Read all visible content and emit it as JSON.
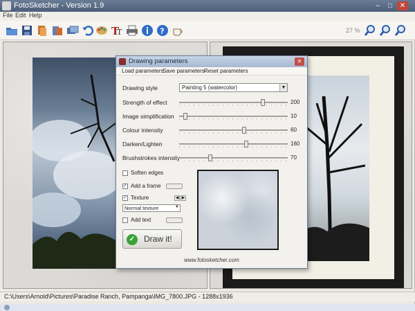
{
  "window": {
    "title": "FotoSketcher - Version 1.9"
  },
  "menu": {
    "items": [
      "File",
      "Edit",
      "Help"
    ]
  },
  "toolbar": {
    "icons": [
      "open-folder-icon",
      "save-icon",
      "copy-icon",
      "paste-icon",
      "batch-icon",
      "undo-icon",
      "palette-icon",
      "text-icon",
      "print-icon",
      "info-icon",
      "help-icon",
      "coffee-icon"
    ],
    "zoom_label": "27 %"
  },
  "status": {
    "path": "C:\\Users\\Arnold\\Pictures\\Paradise Ranch, Pampanga\\IMG_7800.JPG - 1288x1936"
  },
  "dialog": {
    "title": "Drawing parameters",
    "menu": [
      "Load parameters",
      "Save parameters",
      "Reset parameters"
    ],
    "drawing_style_label": "Drawing style",
    "drawing_style_value": "Painting 5 (watercolor)",
    "sliders": [
      {
        "label": "Strength of effect",
        "value": "200",
        "position": 0.78
      },
      {
        "label": "Image simplification",
        "value": "10",
        "position": 0.04
      },
      {
        "label": "Colour intensity",
        "value": "60",
        "position": 0.6
      },
      {
        "label": "Darken/Lighten",
        "value": "160",
        "position": 0.62
      },
      {
        "label": "Brushstrokes intensity",
        "value": "70",
        "position": 0.28
      }
    ],
    "soften_edges": {
      "label": "Soften edges",
      "checked": false
    },
    "add_frame": {
      "label": "Add a frame",
      "checked": true
    },
    "texture": {
      "label": "Texture",
      "checked": true,
      "selected": "Normal texture"
    },
    "add_text": {
      "label": "Add text",
      "checked": false
    },
    "draw_button": "Draw it!",
    "website": "www.fotosketcher.com"
  }
}
